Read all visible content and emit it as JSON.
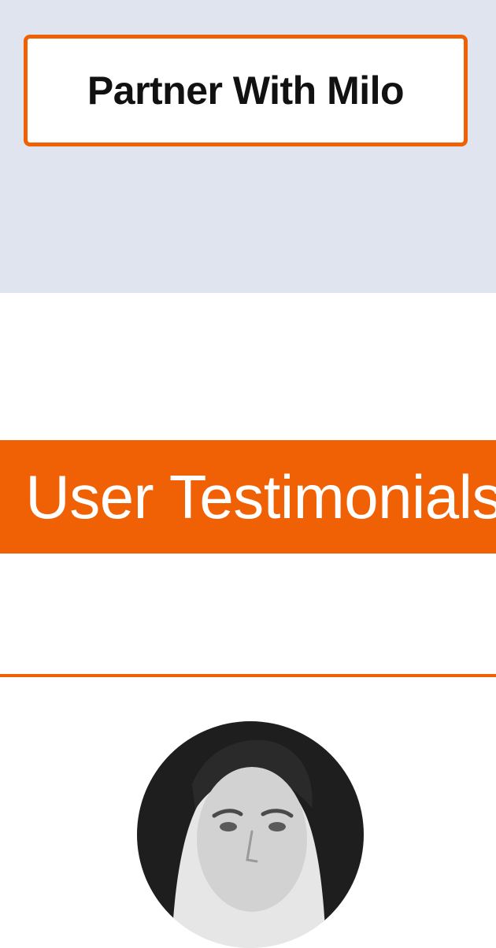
{
  "cta": {
    "partner_label": "Partner With Milo"
  },
  "testimonials": {
    "heading": "User Testimonials",
    "avatar_icon": "person-portrait"
  },
  "colors": {
    "accent": "#ef6104",
    "band_background": "#dfe4ef",
    "page_background": "#ffffff"
  }
}
